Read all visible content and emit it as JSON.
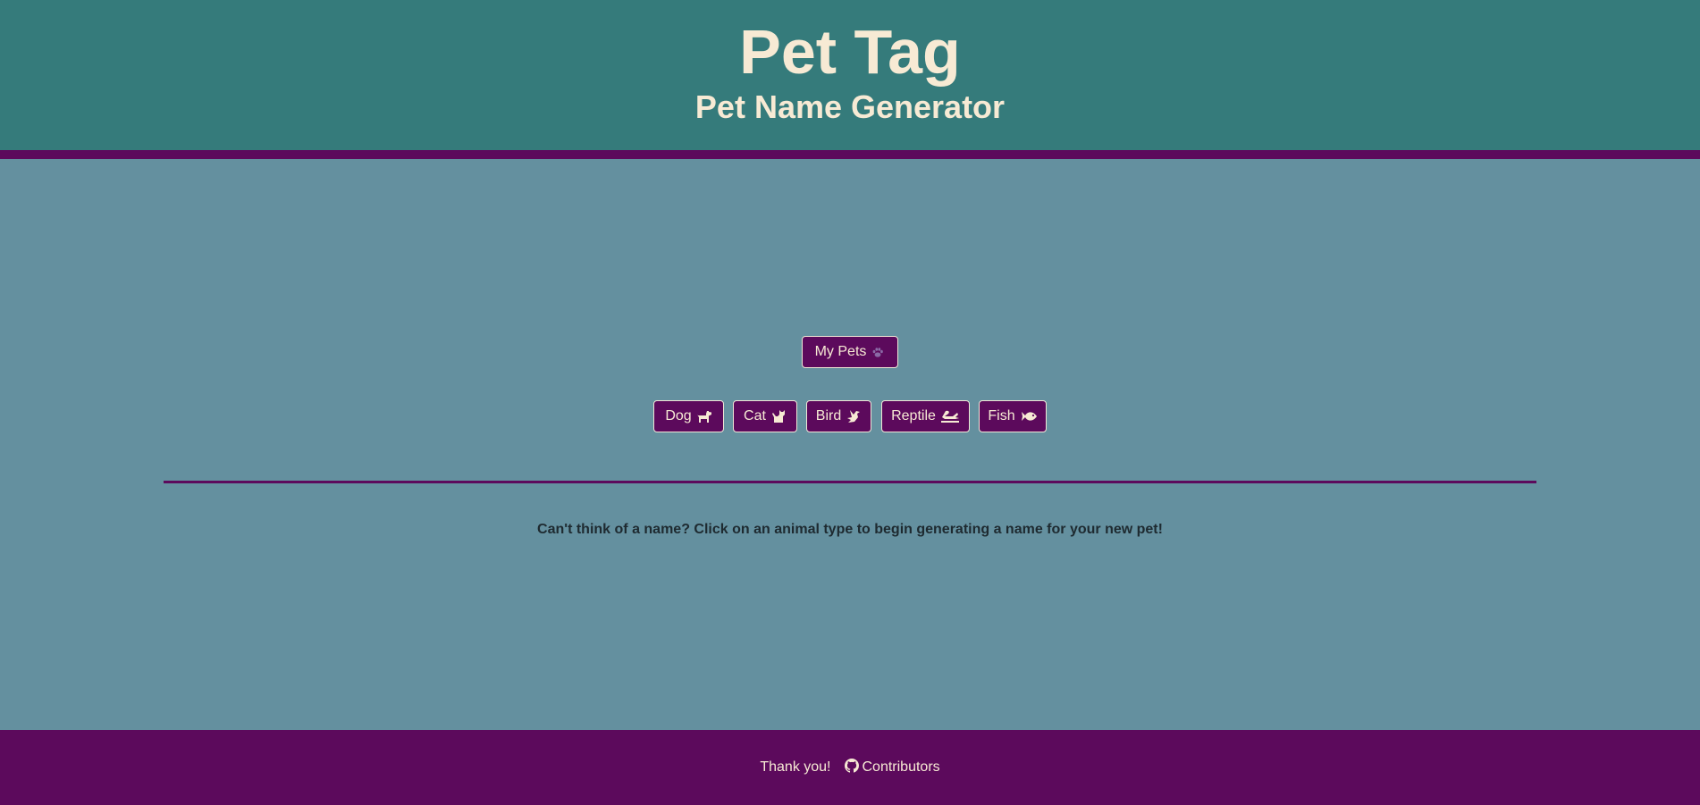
{
  "header": {
    "title": "Pet Tag",
    "subtitle": "Pet Name Generator"
  },
  "my_pets": {
    "label": "My Pets",
    "icon": "paw-icon"
  },
  "animals": [
    {
      "label": "Dog",
      "icon": "dog-icon"
    },
    {
      "label": "Cat",
      "icon": "cat-icon"
    },
    {
      "label": "Bird",
      "icon": "dove-icon"
    },
    {
      "label": "Reptile",
      "icon": "reptile-icon"
    },
    {
      "label": "Fish",
      "icon": "fish-icon"
    }
  ],
  "main": {
    "prompt": "Can't think of a name? Click on an animal type to begin generating a name for your new pet!"
  },
  "footer": {
    "thanks": "Thank you!",
    "contributors_label": "Contributors",
    "contributors_icon": "github-icon"
  },
  "colors": {
    "header_bg": "#357b7b",
    "page_bg": "#64909f",
    "accent_purple": "#5c0a5c",
    "cream_text": "#f7ead4"
  }
}
